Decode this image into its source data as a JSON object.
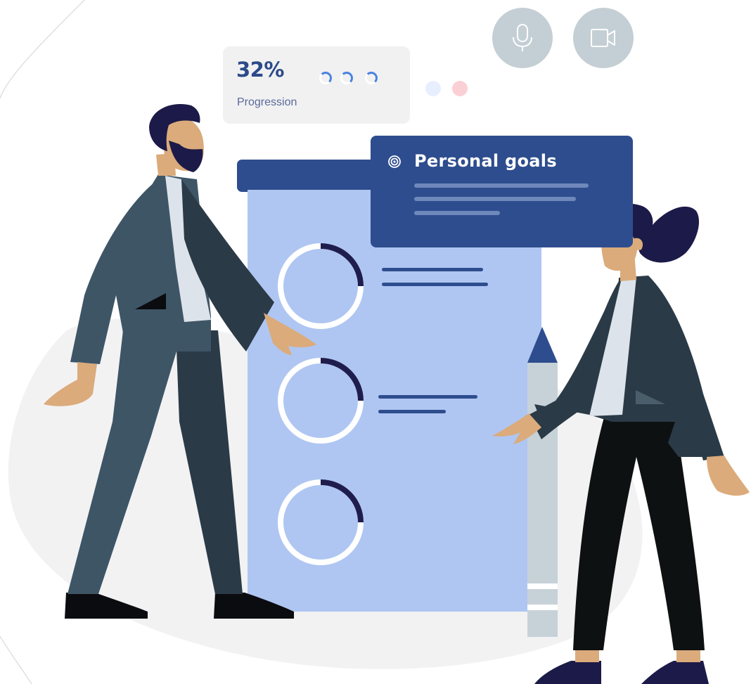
{
  "progress_card": {
    "value": "32%",
    "label": "Progression"
  },
  "goals_card": {
    "title": "Personal goals",
    "icon": "target-icon"
  },
  "call_controls": {
    "mic_icon": "microphone-icon",
    "camera_icon": "video-camera-icon"
  },
  "colors": {
    "primary": "#2e4d8e",
    "document": "#afc6f2",
    "progress_blue": "#4a83e0",
    "button_gray": "#c4cfd5",
    "background_blob": "#f2f2f3"
  }
}
